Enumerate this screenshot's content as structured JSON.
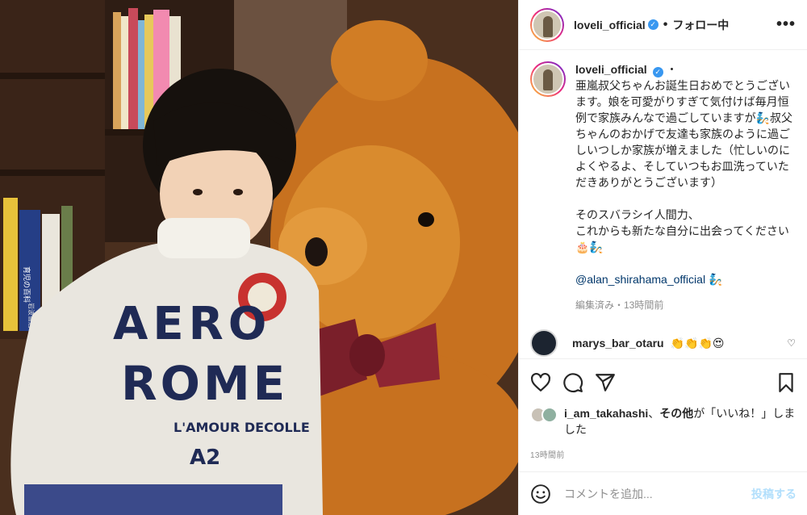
{
  "header": {
    "username": "loveli_official",
    "separator": "•",
    "follow_label": "フォロー中",
    "more_label": "•••"
  },
  "caption": {
    "username": "loveli_official",
    "separator": "・",
    "text": "亜嵐叔父ちゃんお誕生日おめでとうございます。娘を可愛がりすぎて気付けば毎月恒例で家族みんなで過ごしていますが🧞叔父ちゃんのおかげで友達も家族のように過ごしいつしか家族が増えました（忙しいのによくやるよ、そしていつもお皿洗っていただきありがとうございます）\n\nそのスバラシイ人間力、\nこれからも新たな自分に出会ってください🎂🧞",
    "mention": "@alan_shirahama_official",
    "mention_suffix": " 🧞",
    "meta": "編集済み・13時間前"
  },
  "comment": {
    "username": "marys_bar_otaru",
    "text": "👏👏👏😍"
  },
  "likes": {
    "user": "i_am_takahashi",
    "sep": "、",
    "others": "その他",
    "suffix": "が「いいね！」しました"
  },
  "timestamp": "13時間前",
  "add_comment": {
    "placeholder": "コメントを追加...",
    "post_label": "投稿する"
  },
  "icons": [
    "heart-icon",
    "comment-icon",
    "share-icon",
    "bookmark-icon",
    "emoji-icon",
    "more-icon",
    "verified-icon"
  ],
  "colors": {
    "accent": "#3897f0",
    "post_disabled": "#b2dffc",
    "muted": "#8e8e8e",
    "mention": "#00376b"
  },
  "photo": {
    "sweater_text_1": "AERO",
    "sweater_text_2": "ROME",
    "sweater_text_3": "L'AMOUR DECOLLE",
    "sweater_text_4": "A2",
    "book_1": "育児の百科",
    "book_2": "岩波書店"
  }
}
